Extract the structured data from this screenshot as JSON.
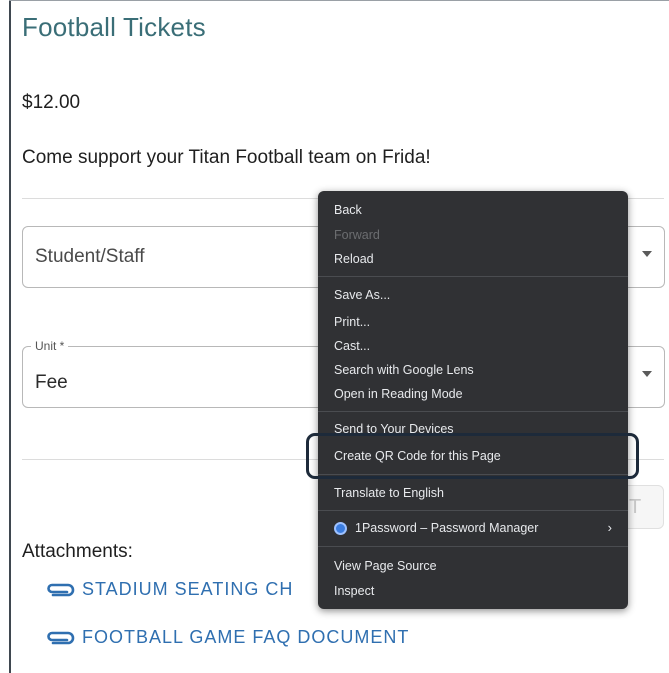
{
  "page": {
    "title": "Football Tickets",
    "price": "$12.00",
    "description": "Come support your Titan Football team on Frida!"
  },
  "form": {
    "category_select": {
      "value": "Student/Staff"
    },
    "unit_select": {
      "label": "Unit *",
      "value": "Fee"
    }
  },
  "ghost_button": {
    "label": "T"
  },
  "attachments": {
    "label": "Attachments:",
    "items": [
      {
        "label": "STADIUM SEATING CH"
      },
      {
        "label": "FOOTBALL GAME FAQ DOCUMENT"
      }
    ]
  },
  "context_menu": {
    "back": "Back",
    "forward": "Forward",
    "reload": "Reload",
    "save_as": "Save As...",
    "print": "Print...",
    "cast": "Cast...",
    "search_lens": "Search with Google Lens",
    "reading_mode": "Open in Reading Mode",
    "send_devices": "Send to Your Devices",
    "create_qr": "Create QR Code for this Page",
    "translate": "Translate to English",
    "password_manager": "1Password – Password Manager",
    "view_source": "View Page Source",
    "inspect": "Inspect"
  },
  "colors": {
    "title": "#3a6e77",
    "link": "#2f6fb0",
    "menu_bg": "#303134",
    "menu_text": "#e8eaed",
    "highlight_border": "#1d2a3a"
  }
}
